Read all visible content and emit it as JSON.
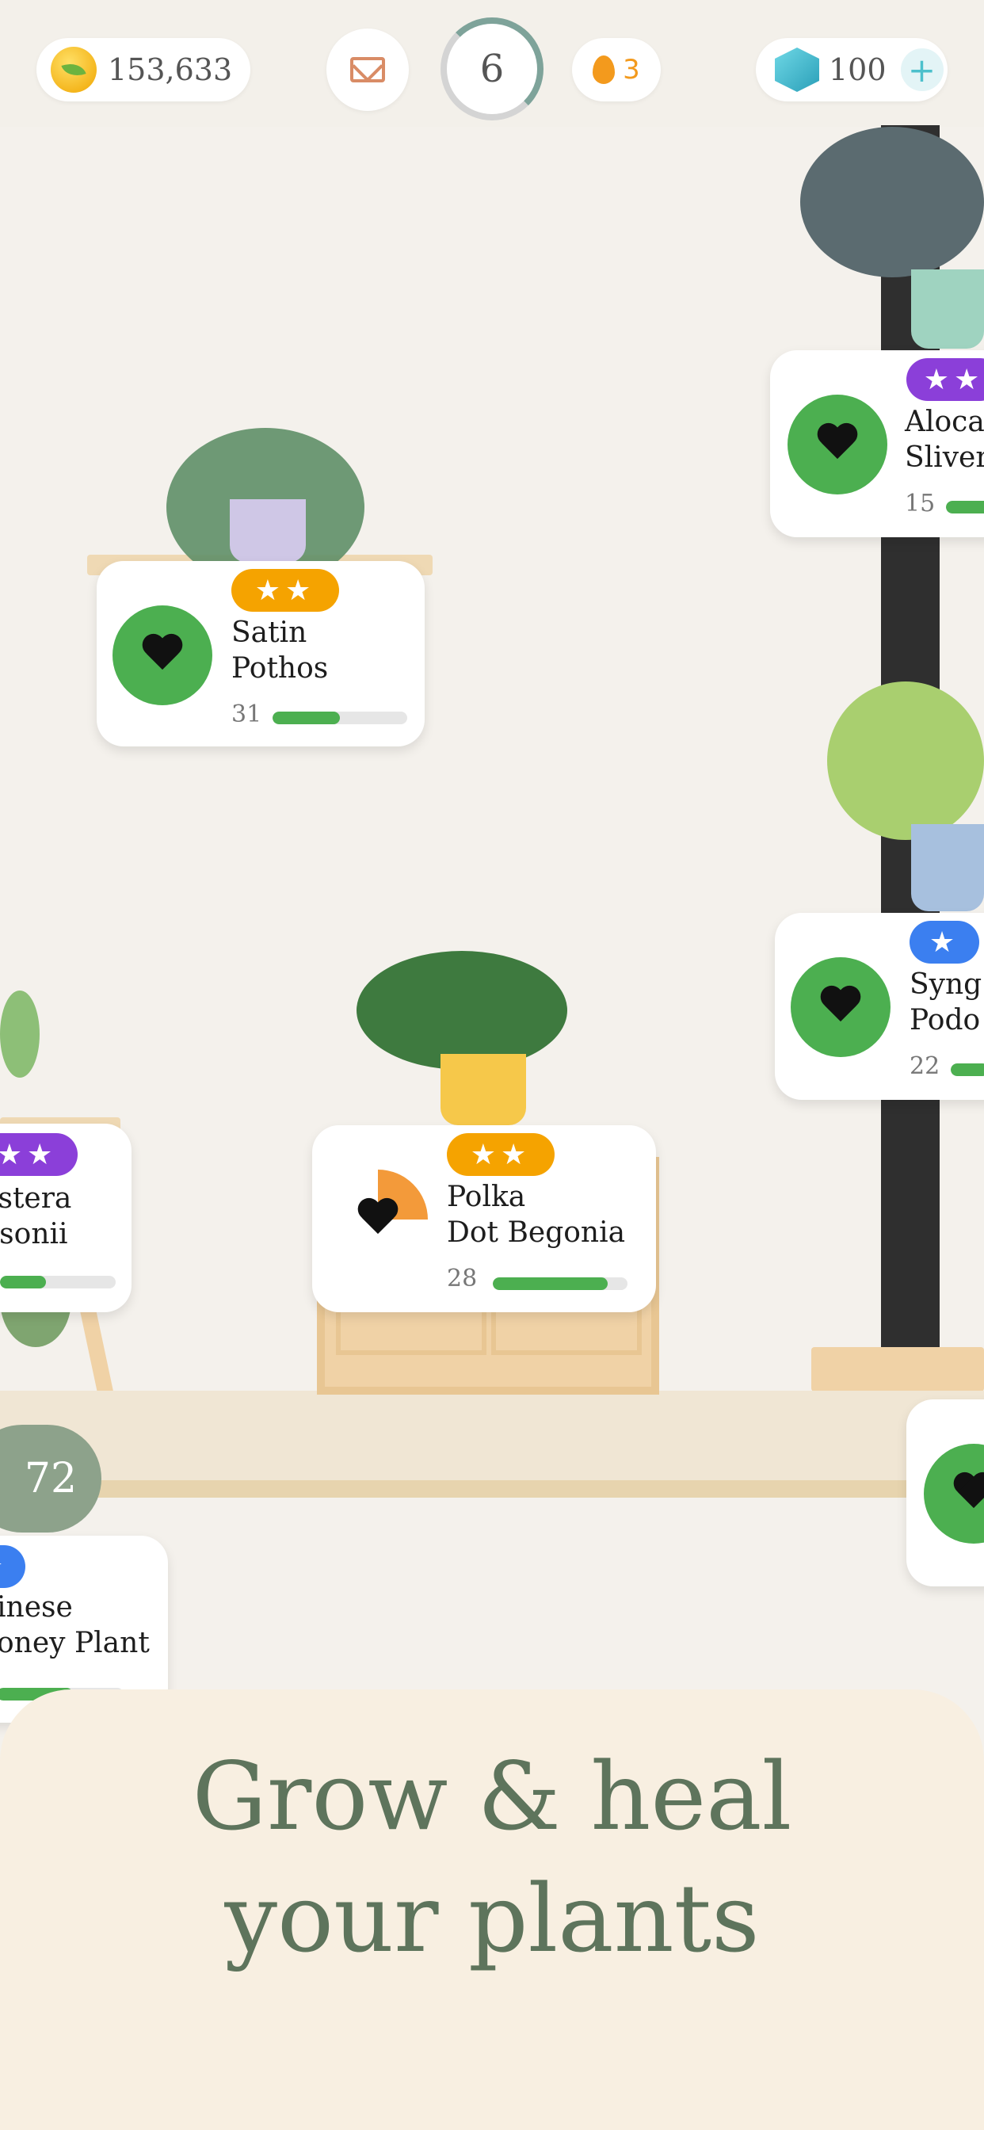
{
  "top_bar": {
    "coins": "153,633",
    "level": "6",
    "streak": "3",
    "gems": "100",
    "gems_add": "+"
  },
  "plants": [
    {
      "name": "Satin\nPothos",
      "level": "31",
      "stars": "★★",
      "star_color": "#f5a300",
      "health_color": "#4caf50",
      "progress": 0.5
    },
    {
      "name": "Aloca\nSliver",
      "level": "15",
      "stars": "★★",
      "star_color": "#8b3fd9",
      "health_color": "#4caf50",
      "progress": 0.8
    },
    {
      "name": "Syng\nPodo",
      "level": "22",
      "stars": "★",
      "star_color": "#3b7ff0",
      "health_color": "#4caf50",
      "progress": 0.8
    },
    {
      "name": "astera\nnsonii",
      "level": "",
      "stars": "★★",
      "star_color": "#8b3fd9",
      "health_color": "#4caf50",
      "progress": 0.4
    },
    {
      "name": "Polka\nDot Begonia",
      "level": "28",
      "stars": "★★",
      "star_color": "#f5a300",
      "health_color": "#f39a3a",
      "progress": 0.85
    },
    {
      "name": "inese\noney Plant",
      "level": "",
      "stars": "★",
      "star_color": "#3b7ff0",
      "health_color": "#4caf50",
      "progress": 0.6
    }
  ],
  "partial_badge": "72",
  "headline": "Grow & heal\nyour plants"
}
